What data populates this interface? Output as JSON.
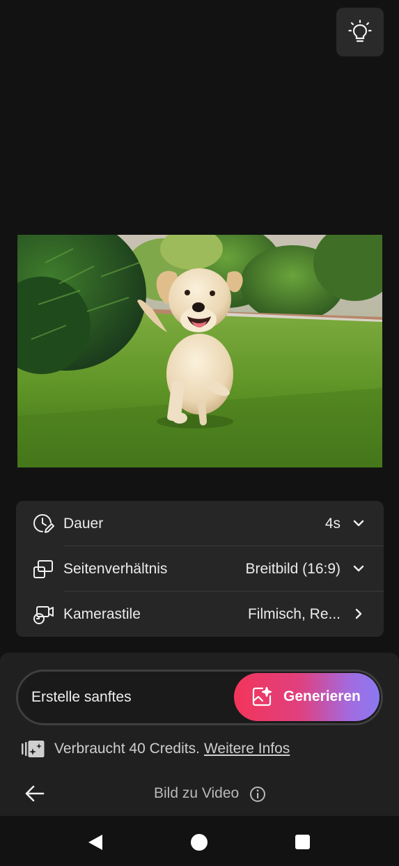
{
  "toolbar": {
    "tip_icon": "lightbulb-icon"
  },
  "preview": {
    "subject": "photo"
  },
  "settings": {
    "rows": [
      {
        "icon": "clock-pencil-icon",
        "label": "Dauer",
        "value": "4s",
        "control": "chevron-down-icon"
      },
      {
        "icon": "aspect-ratio-icon",
        "label": "Seitenverhältnis",
        "value": "Breitbild (16:9)",
        "control": "chevron-down-icon"
      },
      {
        "icon": "camera-style-icon",
        "label": "Kamerastile",
        "value": "Filmisch, Re...",
        "control": "chevron-right-icon"
      }
    ]
  },
  "prompt": {
    "text": "Erstelle sanftes"
  },
  "generate": {
    "label": "Generieren",
    "icon": "sparkle-image-icon",
    "gradient": [
      "#f2355a",
      "#8a7af0"
    ]
  },
  "credits": {
    "text": "Verbraucht 40 Credits.",
    "link": "Weitere Infos",
    "icon": "credits-icon"
  },
  "footer": {
    "title": "Bild zu Video",
    "back_icon": "arrow-left-icon",
    "info_icon": "info-icon"
  },
  "system_nav": {
    "back": "nav-back-icon",
    "home": "nav-home-icon",
    "recents": "nav-recents-icon"
  }
}
